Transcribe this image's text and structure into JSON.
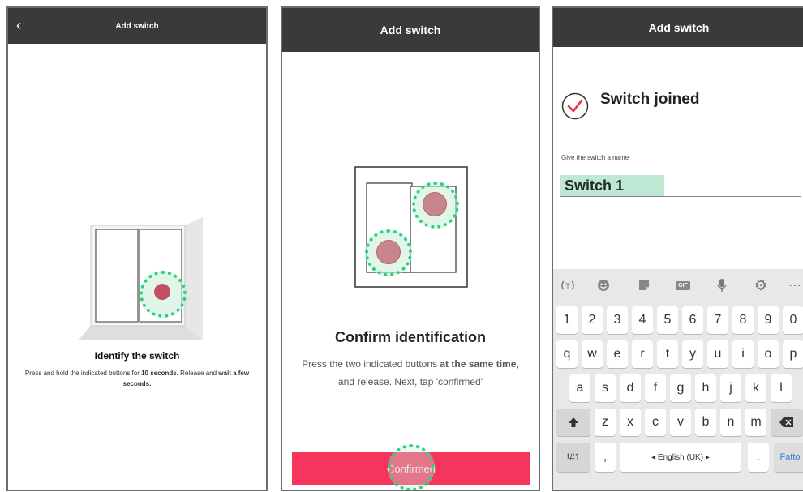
{
  "screen1": {
    "title": "Add switch",
    "back_icon": "chevron-left-icon",
    "heading": "Identify the switch",
    "desc_part1": "Press and hold the indicated buttons for ",
    "desc_bold1": "10 seconds.",
    "desc_part2": " Release and ",
    "desc_bold2": "wait a few seconds."
  },
  "screen2": {
    "title": "Add switch",
    "heading": "Confirm identification",
    "desc_part1": "Press the two indicated buttons ",
    "desc_bold1": "at the same time,",
    "desc_part2": " and release. Next, tap 'confirmed'",
    "button_label": "Confirmed",
    "button_color": "#f5355e"
  },
  "screen3": {
    "title": "Add switch",
    "status": "Switch joined",
    "status_icon": "check-circle-icon",
    "field_label": "Give the switch a name",
    "field_value": "Switch 1",
    "keyboard": {
      "toolbar_icons": [
        "translate-icon",
        "emoji-icon",
        "sticker-icon",
        "gif-icon",
        "microphone-icon",
        "settings-icon",
        "more-icon"
      ],
      "gif_label": "GIF",
      "numbers": [
        "1",
        "2",
        "3",
        "4",
        "5",
        "6",
        "7",
        "8",
        "9",
        "0"
      ],
      "row1": [
        "q",
        "w",
        "e",
        "r",
        "t",
        "y",
        "u",
        "i",
        "o",
        "p"
      ],
      "row2": [
        "a",
        "s",
        "d",
        "f",
        "g",
        "h",
        "j",
        "k",
        "l"
      ],
      "row3": [
        "z",
        "x",
        "c",
        "v",
        "b",
        "n",
        "m"
      ],
      "shift_icon": "shift-icon",
      "backspace_icon": "backspace-icon",
      "symbols_label": "!#1",
      "comma_label": ",",
      "space_label": "◂ English (UK) ▸",
      "period_label": ".",
      "done_label": "Fatto"
    }
  }
}
